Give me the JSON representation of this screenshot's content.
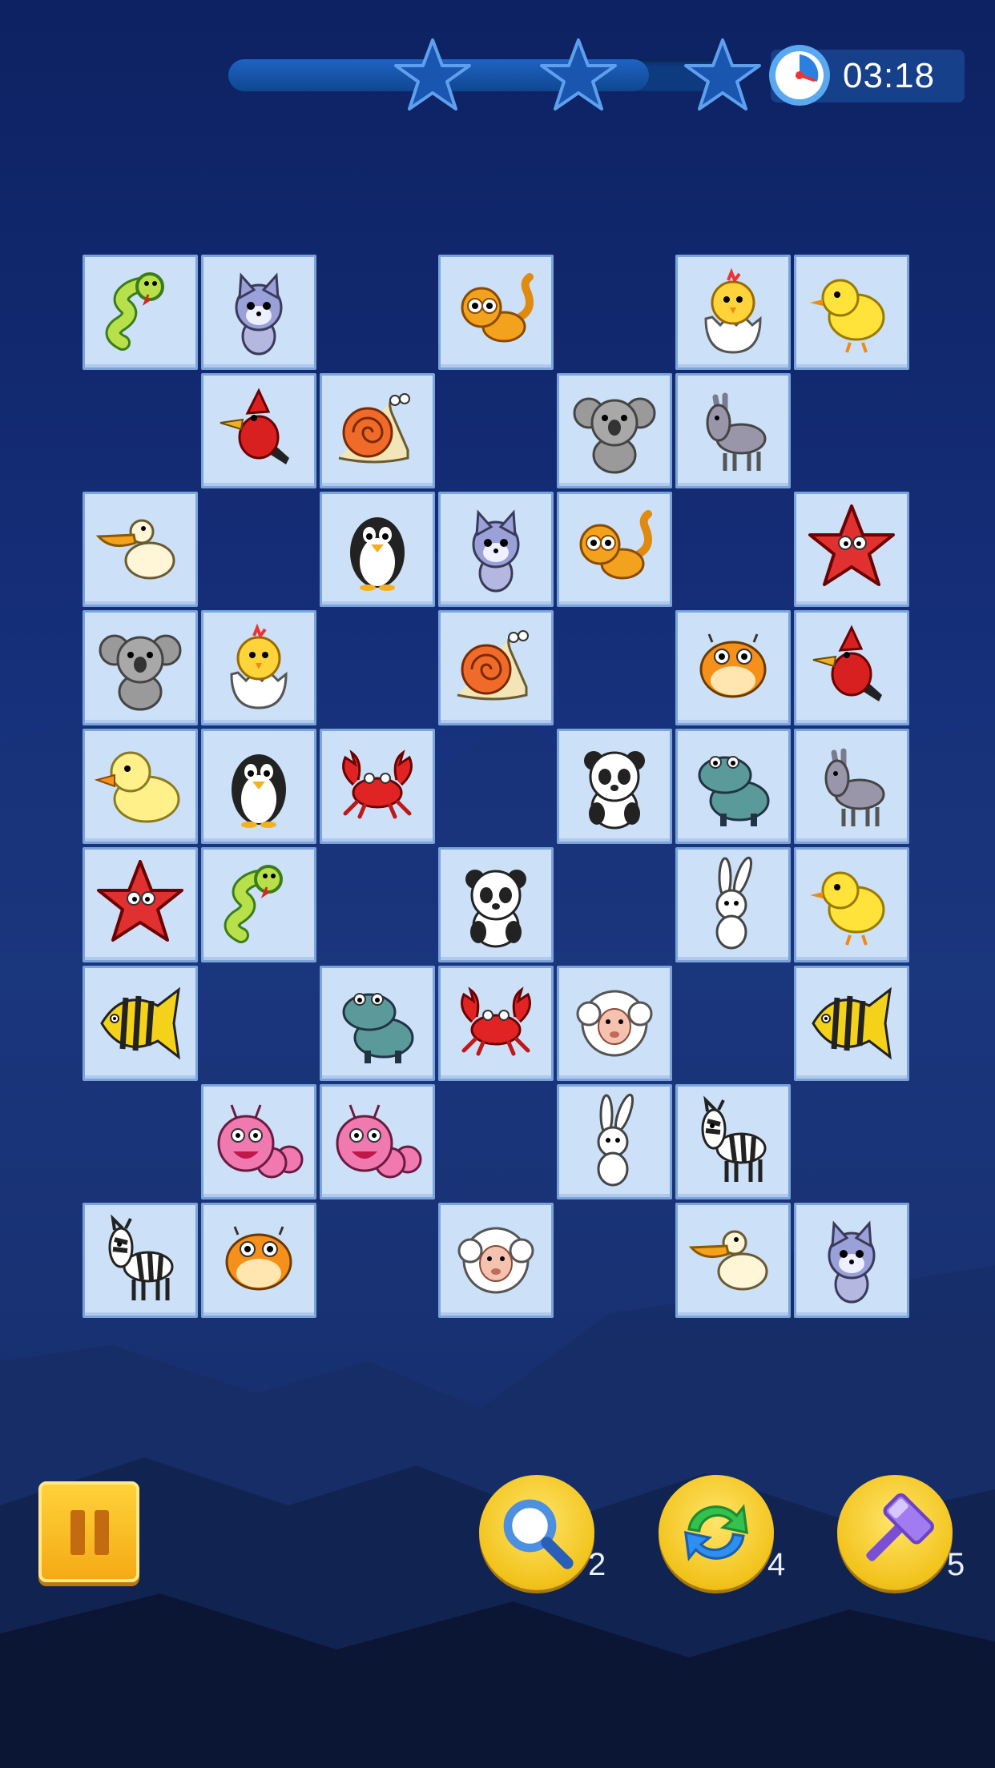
{
  "hud": {
    "timer": "03:18",
    "stars_earned": 0,
    "stars_total": 3,
    "progress": 0.82
  },
  "board": {
    "cols": 7,
    "rows": 9,
    "tiles": [
      {
        "row": 0,
        "col": 0,
        "animal": "snake"
      },
      {
        "row": 0,
        "col": 1,
        "animal": "wolf"
      },
      {
        "row": 0,
        "col": 3,
        "animal": "lemur"
      },
      {
        "row": 0,
        "col": 5,
        "animal": "chick-egg"
      },
      {
        "row": 0,
        "col": 6,
        "animal": "chick"
      },
      {
        "row": 1,
        "col": 1,
        "animal": "cardinal"
      },
      {
        "row": 1,
        "col": 2,
        "animal": "snail"
      },
      {
        "row": 1,
        "col": 4,
        "animal": "koala"
      },
      {
        "row": 1,
        "col": 5,
        "animal": "donkey"
      },
      {
        "row": 2,
        "col": 0,
        "animal": "pelican"
      },
      {
        "row": 2,
        "col": 2,
        "animal": "penguin"
      },
      {
        "row": 2,
        "col": 3,
        "animal": "wolf"
      },
      {
        "row": 2,
        "col": 4,
        "animal": "lemur"
      },
      {
        "row": 2,
        "col": 6,
        "animal": "starfish"
      },
      {
        "row": 3,
        "col": 0,
        "animal": "koala"
      },
      {
        "row": 3,
        "col": 1,
        "animal": "chick-egg"
      },
      {
        "row": 3,
        "col": 3,
        "animal": "snail"
      },
      {
        "row": 3,
        "col": 5,
        "animal": "pufferfish"
      },
      {
        "row": 3,
        "col": 6,
        "animal": "cardinal"
      },
      {
        "row": 4,
        "col": 0,
        "animal": "duck"
      },
      {
        "row": 4,
        "col": 1,
        "animal": "penguin"
      },
      {
        "row": 4,
        "col": 2,
        "animal": "crab"
      },
      {
        "row": 4,
        "col": 4,
        "animal": "panda"
      },
      {
        "row": 4,
        "col": 5,
        "animal": "hippo"
      },
      {
        "row": 4,
        "col": 6,
        "animal": "donkey"
      },
      {
        "row": 5,
        "col": 0,
        "animal": "starfish"
      },
      {
        "row": 5,
        "col": 1,
        "animal": "snake"
      },
      {
        "row": 5,
        "col": 3,
        "animal": "panda"
      },
      {
        "row": 5,
        "col": 5,
        "animal": "rabbit"
      },
      {
        "row": 5,
        "col": 6,
        "animal": "chick"
      },
      {
        "row": 6,
        "col": 0,
        "animal": "angelfish"
      },
      {
        "row": 6,
        "col": 2,
        "animal": "hippo"
      },
      {
        "row": 6,
        "col": 3,
        "animal": "crab"
      },
      {
        "row": 6,
        "col": 4,
        "animal": "sheep"
      },
      {
        "row": 6,
        "col": 6,
        "animal": "angelfish"
      },
      {
        "row": 7,
        "col": 1,
        "animal": "caterpillar"
      },
      {
        "row": 7,
        "col": 2,
        "animal": "caterpillar"
      },
      {
        "row": 7,
        "col": 4,
        "animal": "rabbit"
      },
      {
        "row": 7,
        "col": 5,
        "animal": "zebra"
      },
      {
        "row": 8,
        "col": 0,
        "animal": "zebra"
      },
      {
        "row": 8,
        "col": 1,
        "animal": "pufferfish"
      },
      {
        "row": 8,
        "col": 3,
        "animal": "sheep"
      },
      {
        "row": 8,
        "col": 5,
        "animal": "pelican"
      },
      {
        "row": 8,
        "col": 6,
        "animal": "wolf"
      }
    ]
  },
  "tools": {
    "hint": {
      "icon": "magnifier-icon",
      "count": "2"
    },
    "shuffle": {
      "icon": "shuffle-icon",
      "count": "4"
    },
    "hammer": {
      "icon": "hammer-icon",
      "count": "5"
    }
  },
  "pause_icon": "pause-icon"
}
